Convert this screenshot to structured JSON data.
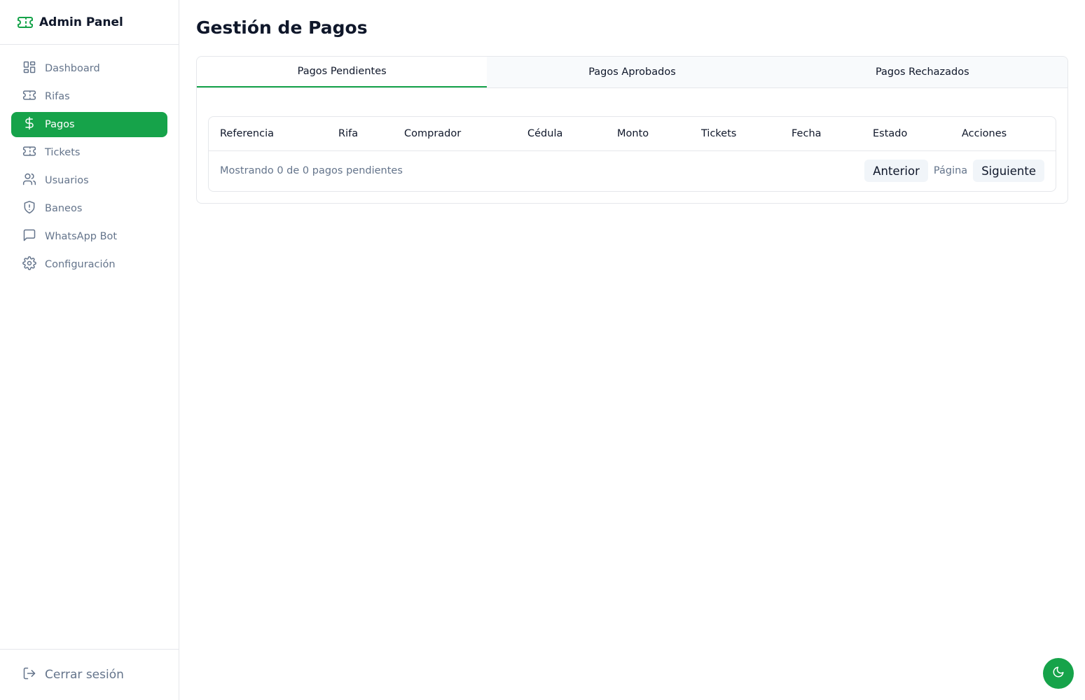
{
  "brand": {
    "title": "Admin Panel",
    "icon": "ticket-icon",
    "accent": "#16a34a"
  },
  "sidebar": {
    "items": [
      {
        "label": "Dashboard",
        "icon": "layout-dashboard-icon",
        "active": false
      },
      {
        "label": "Rifas",
        "icon": "ticket-icon",
        "active": false
      },
      {
        "label": "Pagos",
        "icon": "dollar-sign-icon",
        "active": true
      },
      {
        "label": "Tickets",
        "icon": "ticket-icon",
        "active": false
      },
      {
        "label": "Usuarios",
        "icon": "users-icon",
        "active": false
      },
      {
        "label": "Baneos",
        "icon": "shield-icon",
        "active": false
      },
      {
        "label": "WhatsApp Bot",
        "icon": "message-square-icon",
        "active": false
      },
      {
        "label": "Configuración",
        "icon": "settings-icon",
        "active": false
      }
    ],
    "logout_label": "Cerrar sesión"
  },
  "main": {
    "title": "Gestión de Pagos",
    "tabs": [
      {
        "label": "Pagos Pendientes",
        "active": true
      },
      {
        "label": "Pagos Aprobados",
        "active": false
      },
      {
        "label": "Pagos Rechazados",
        "active": false
      }
    ],
    "table": {
      "columns": [
        "Referencia",
        "Rifa",
        "Comprador",
        "Cédula",
        "Monto",
        "Tickets",
        "Fecha",
        "Estado",
        "Acciones"
      ],
      "rows": []
    },
    "footer": {
      "count_text": "Mostrando 0 de 0 pagos pendientes",
      "prev_label": "Anterior",
      "page_label": "Página",
      "next_label": "Siguiente"
    }
  },
  "theme_toggle": {
    "icon": "moon-icon"
  }
}
